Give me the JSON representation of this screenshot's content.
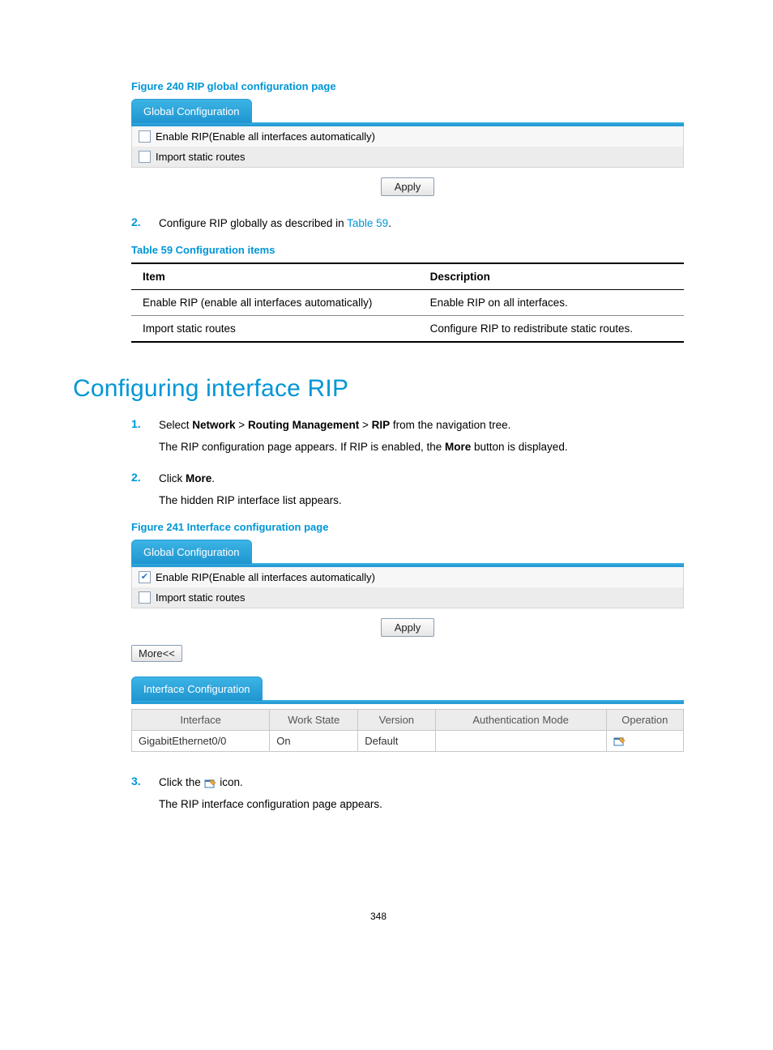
{
  "figure240": {
    "caption": "Figure 240 RIP global configuration page",
    "tab": "Global Configuration",
    "row1": "Enable RIP(Enable all interfaces automatically)",
    "row2": "Import static routes",
    "apply": "Apply"
  },
  "step2": {
    "num": "2.",
    "text_prefix": "Configure RIP globally as described in ",
    "link": "Table 59",
    "text_suffix": "."
  },
  "table59": {
    "caption": "Table 59 Configuration items",
    "head_item": "Item",
    "head_desc": "Description",
    "rows": [
      {
        "item": "Enable RIP (enable all interfaces automatically)",
        "desc": "Enable RIP on all interfaces."
      },
      {
        "item": "Import static routes",
        "desc": "Configure RIP to redistribute static routes."
      }
    ]
  },
  "section_heading": "Configuring interface RIP",
  "iface_steps": {
    "s1": {
      "num": "1.",
      "line1_a": "Select ",
      "nav1": "Network",
      "gt1": " > ",
      "nav2": "Routing Management",
      "gt2": " > ",
      "nav3": "RIP",
      "line1_b": " from the navigation tree.",
      "line2_a": "The RIP configuration page appears. If RIP is enabled, the ",
      "more": "More",
      "line2_b": " button is displayed."
    },
    "s2": {
      "num": "2.",
      "line1_a": "Click ",
      "more": "More",
      "line1_b": ".",
      "line2": "The hidden RIP interface list appears."
    },
    "s3": {
      "num": "3.",
      "line1_a": "Click the ",
      "line1_b": " icon.",
      "line2": "The RIP interface configuration page appears."
    }
  },
  "figure241": {
    "caption": "Figure 241 Interface configuration page",
    "tab_global": "Global Configuration",
    "row1": "Enable RIP(Enable all interfaces automatically)",
    "row2": "Import static routes",
    "apply": "Apply",
    "more_btn": "More<<",
    "tab_iface": "Interface Configuration",
    "headers": {
      "iface": "Interface",
      "work": "Work State",
      "ver": "Version",
      "auth": "Authentication Mode",
      "op": "Operation"
    },
    "data": {
      "iface": "GigabitEthernet0/0",
      "work": "On",
      "ver": "Default",
      "auth": ""
    }
  },
  "page_number": "348"
}
